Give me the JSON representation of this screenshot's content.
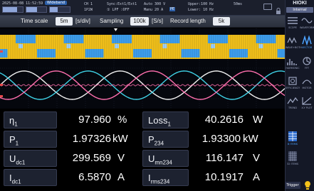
{
  "status": {
    "datetime": "2025-08-08 11:52:59",
    "badge": "Wideband",
    "ch": "CH 1",
    "ch_sub": "1P2W",
    "sync": "Sync:Ext1/Ext1",
    "lpf": "① LPF :OFF",
    "range_mode": "Auto 300 V",
    "range_cur": "Manu 20 A",
    "pe_badge": "PE",
    "upper": "Upper:100 Hz",
    "lower": "Lower: 10 Hz",
    "rate": "50ms"
  },
  "brand": {
    "name": "HIOKI",
    "mode": "Internal"
  },
  "settings": {
    "time_scale_label": "Time scale",
    "time_scale_value": "5m",
    "time_scale_unit": "[s/div]",
    "sampling_label": "Sampling",
    "sampling_value": "100k",
    "sampling_unit": "[S/s]",
    "record_label": "Record length",
    "record_value": "5k"
  },
  "side_buttons": [
    {
      "id": "scope",
      "label": "SCOPE"
    },
    {
      "id": "waveform",
      "label": "WAVEFORM"
    },
    {
      "id": "wave-both",
      "label": "WAVE+BOTH"
    },
    {
      "id": "vector",
      "label": "VECTOR"
    },
    {
      "id": "harmonic",
      "label": "HARMONIC"
    },
    {
      "id": "fft",
      "label": "FFT"
    },
    {
      "id": "efficiency",
      "label": "EFFICIENCY"
    },
    {
      "id": "motor",
      "label": "MOTOR"
    },
    {
      "id": "trend",
      "label": "TREND"
    },
    {
      "id": "x-y-plot",
      "label": "X-Y PLOT"
    },
    {
      "id": "items",
      "label": "8 ITEMS"
    },
    {
      "id": "items-32",
      "label": "32 ITEMS"
    }
  ],
  "trigger_label": "Trigger",
  "measurements": [
    {
      "label_main": "η",
      "label_sub": "1",
      "value": "97.960",
      "unit": "%"
    },
    {
      "label_main": "Loss",
      "label_sub": "1",
      "value": "40.2616",
      "unit": "W"
    },
    {
      "label_main": "P",
      "label_sub": "1",
      "value": "1.97326",
      "unit": "kW"
    },
    {
      "label_main": "P",
      "label_sub": "234",
      "value": "1.93300",
      "unit": "kW"
    },
    {
      "label_main": "U",
      "label_sub": "dc1",
      "value": "299.569",
      "unit": "V"
    },
    {
      "label_main": "U",
      "label_sub": "mn234",
      "value": "116.147",
      "unit": "V"
    },
    {
      "label_main": "I",
      "label_sub": "dc1",
      "value": "6.5870",
      "unit": "A"
    },
    {
      "label_main": "I",
      "label_sub": "rms234",
      "value": "10.1917",
      "unit": "A"
    }
  ],
  "colors": {
    "yellow": "#f4c21a",
    "blue": "#3ea0f0",
    "pink": "#ff6fae",
    "white": "#f2f2f2",
    "cyan": "#3fd2e6",
    "accent": "#4da3ff"
  }
}
